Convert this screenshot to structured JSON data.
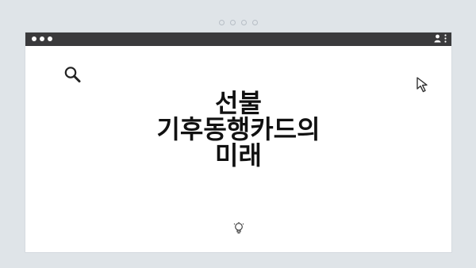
{
  "browser": {
    "top_indicator_dots": 4,
    "window_controls": [
      "close",
      "minimize",
      "maximize"
    ],
    "titlebar_icons": [
      "profile-icon",
      "more-vert-icon"
    ]
  },
  "content": {
    "headline_lines": [
      "선불",
      "기후동행카드의",
      "미래"
    ],
    "icons": [
      "search-icon",
      "cursor-icon",
      "lightbulb-icon"
    ]
  },
  "colors": {
    "background": "#dfe4e8",
    "titlebar": "#3a3a3c",
    "text": "#111111"
  }
}
